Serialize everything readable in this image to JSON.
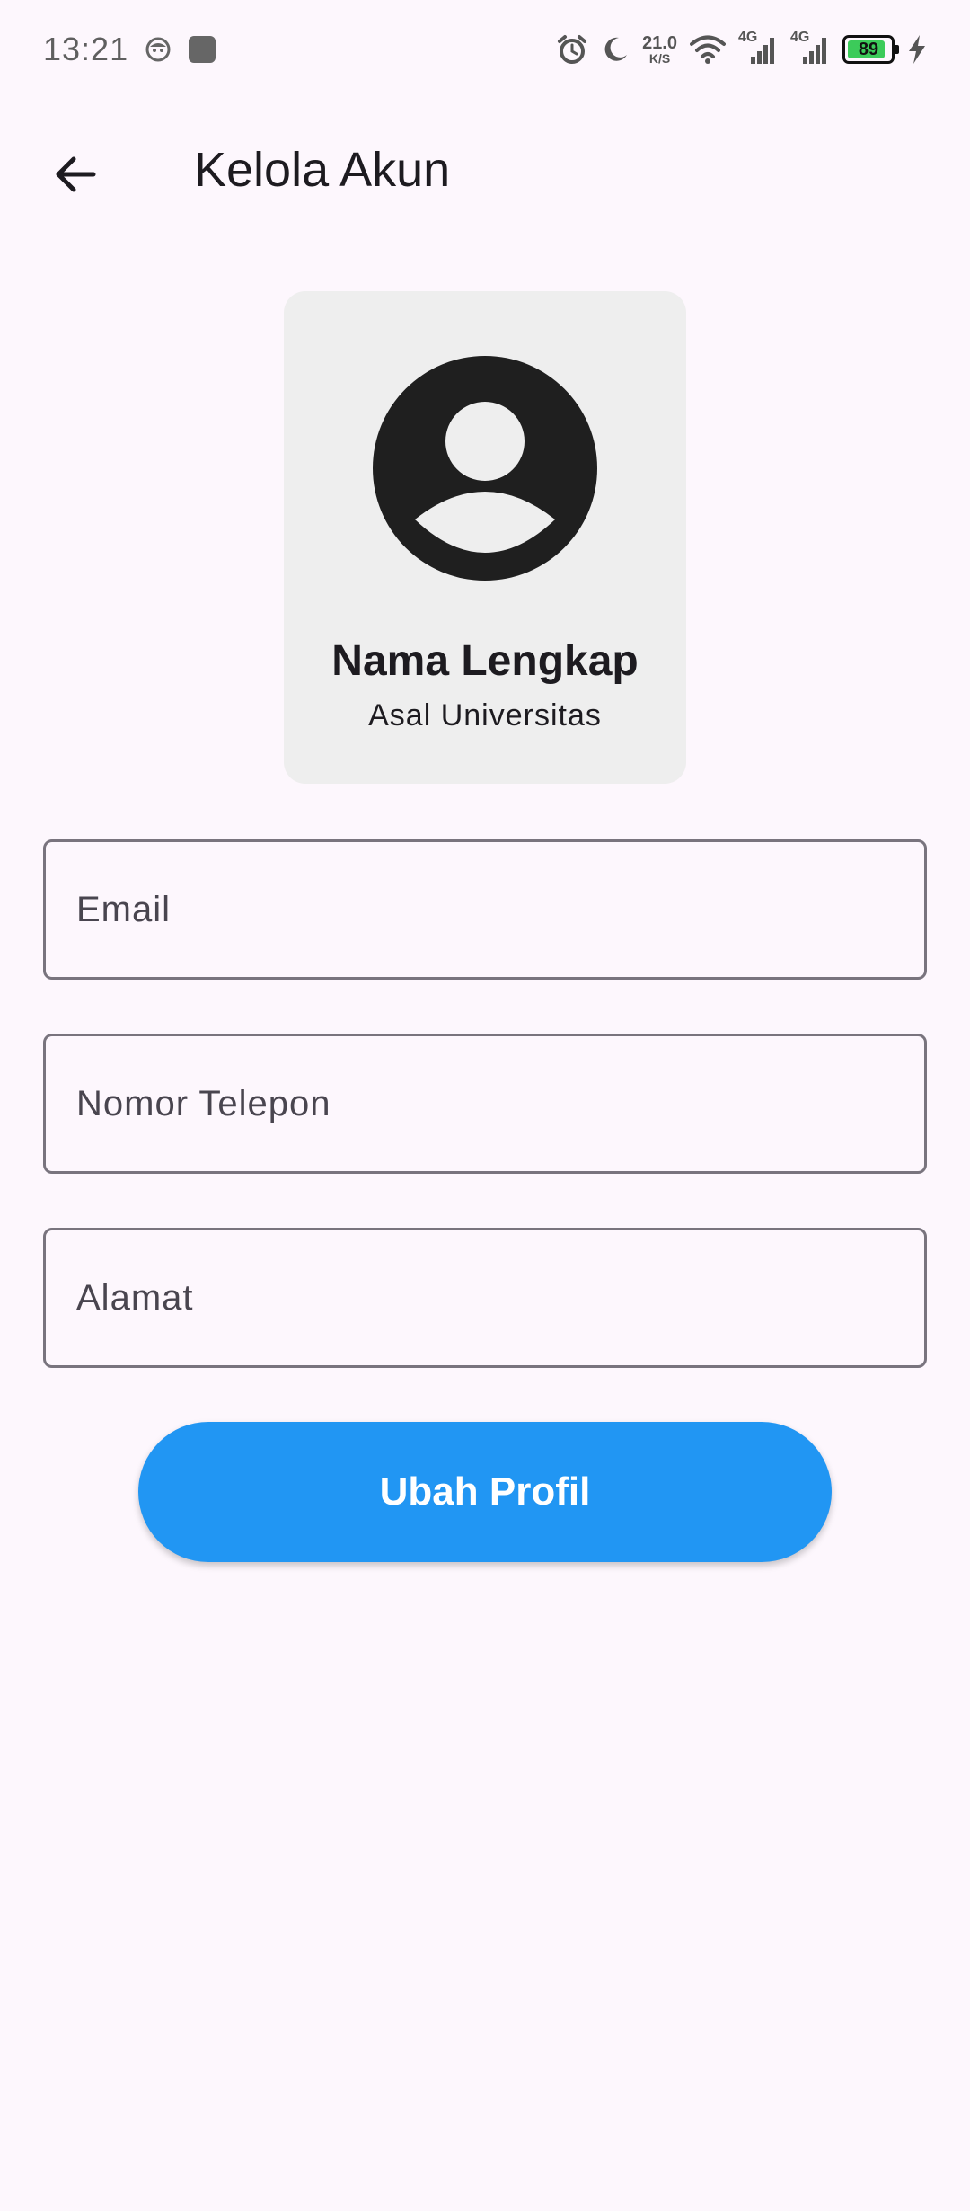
{
  "status_bar": {
    "time": "13:21",
    "net_speed_value": "21.0",
    "net_speed_unit": "K/S",
    "signal_1_label": "4G",
    "signal_2_label": "4G",
    "battery_level": "89",
    "battery_fraction": 0.89,
    "icons": [
      "face-notification-icon",
      "app-notification-icon",
      "alarm-icon",
      "do-not-disturb-moon-icon",
      "wifi-icon",
      "signal-icon",
      "battery-icon",
      "charging-icon"
    ]
  },
  "app_bar": {
    "title": "Kelola Akun",
    "back_icon": "arrow-back-icon"
  },
  "profile": {
    "name": "Nama Lengkap",
    "university": "Asal Universitas",
    "avatar_icon": "account-circle-icon"
  },
  "form": {
    "email_placeholder": "Email",
    "phone_placeholder": "Nomor Telepon",
    "address_placeholder": "Alamat",
    "submit_label": "Ubah Profil"
  },
  "colors": {
    "background": "#fdf7fd",
    "card": "#eeeeee",
    "primary": "#2196f3",
    "field_border": "#79747e",
    "battery_fill": "#3ccb5a"
  }
}
